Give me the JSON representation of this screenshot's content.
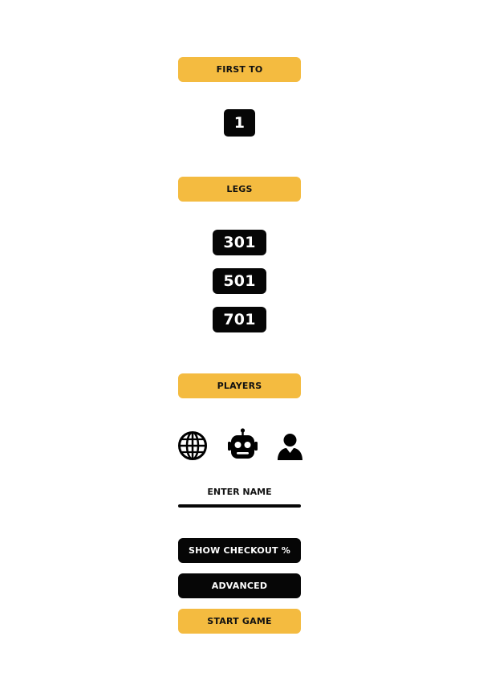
{
  "first_to": {
    "label": "FIRST TO",
    "value": "1"
  },
  "legs": {
    "label": "LEGS",
    "options": [
      "301",
      "501",
      "701"
    ]
  },
  "players": {
    "label": "PLAYERS",
    "icons": [
      "globe-icon",
      "robot-icon",
      "user-icon"
    ],
    "name_placeholder": "ENTER NAME"
  },
  "actions": {
    "show_checkout": "SHOW CHECKOUT %",
    "advanced": "ADVANCED",
    "start_game": "START GAME"
  },
  "colors": {
    "accent": "#f4bb40",
    "dark": "#060606",
    "background": "#ffffff"
  }
}
